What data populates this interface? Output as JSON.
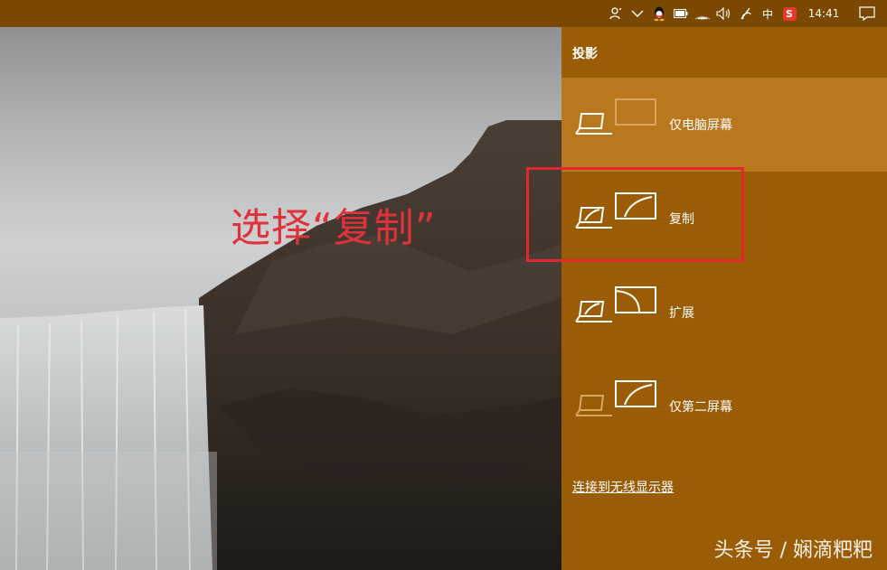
{
  "taskbar": {
    "ime_label": "中",
    "sogou_label": "S",
    "time": "14:41",
    "icons": [
      "people-icon",
      "chevron-up-icon",
      "qq-icon",
      "battery-icon",
      "wifi-icon",
      "volume-icon",
      "pen-icon",
      "notification-icon"
    ]
  },
  "annotation": {
    "text": "选择“复制”",
    "color": "#e0323a"
  },
  "panel": {
    "title": "投影",
    "options": [
      {
        "label": "仅电脑屏幕",
        "icon": "pc-screen-only-icon"
      },
      {
        "label": "复制",
        "icon": "duplicate-icon"
      },
      {
        "label": "扩展",
        "icon": "extend-icon"
      },
      {
        "label": "仅第二屏幕",
        "icon": "second-screen-only-icon"
      }
    ],
    "connect_link": "连接到无线显示器",
    "accent_color": "#9a5c05",
    "selected_color": "#b9781e"
  },
  "watermark": "头条号 / 娴滴粑粑"
}
